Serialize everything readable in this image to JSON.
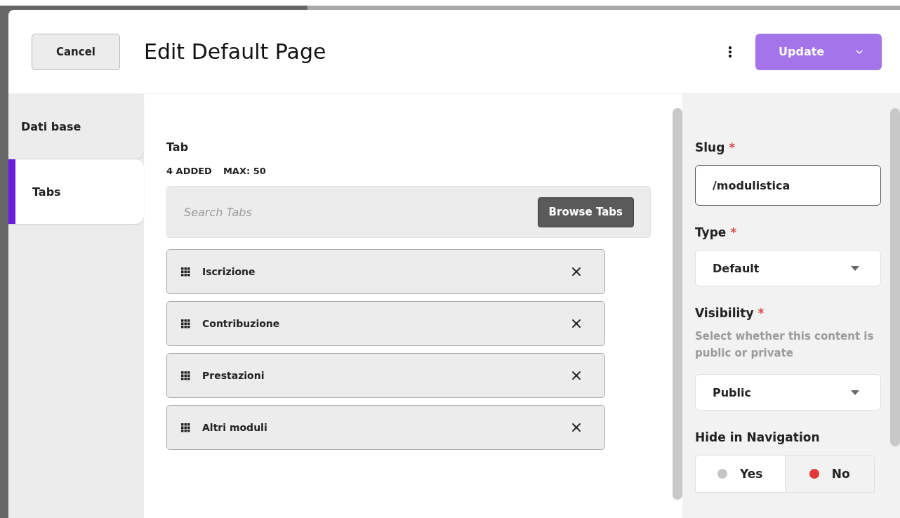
{
  "header": {
    "cancel_button": "Cancel",
    "title": "Edit Default Page",
    "update_button": "Update"
  },
  "sidebar": {
    "items": [
      {
        "label": "Dati base",
        "selected": false
      },
      {
        "label": "Tabs",
        "selected": true
      }
    ]
  },
  "tab_field": {
    "label": "Tab",
    "added": "4 ADDED",
    "max": "MAX: 50",
    "search": {
      "placeholder": "Search Tabs"
    },
    "browse_button": "Browse Tabs",
    "items": [
      {
        "label": "Iscrizione"
      },
      {
        "label": "Contribuzione"
      },
      {
        "label": "Prestazioni"
      },
      {
        "label": "Altri moduli"
      }
    ]
  },
  "settings": {
    "fields": [
      {
        "kind": "text",
        "label": "Slug",
        "required_mark": "*",
        "value": "/modulistica"
      },
      {
        "kind": "select",
        "label": "Type",
        "required_mark": "*",
        "value": "Default"
      },
      {
        "kind": "select",
        "label": "Visibility",
        "required_mark": "*",
        "help": "Select whether this content is public or private",
        "value": "Public"
      },
      {
        "kind": "toggle",
        "label": "Hide in Navigation",
        "options": [
          {
            "label": "Yes",
            "selected": false
          },
          {
            "label": "No",
            "selected": true
          }
        ]
      }
    ]
  }
}
